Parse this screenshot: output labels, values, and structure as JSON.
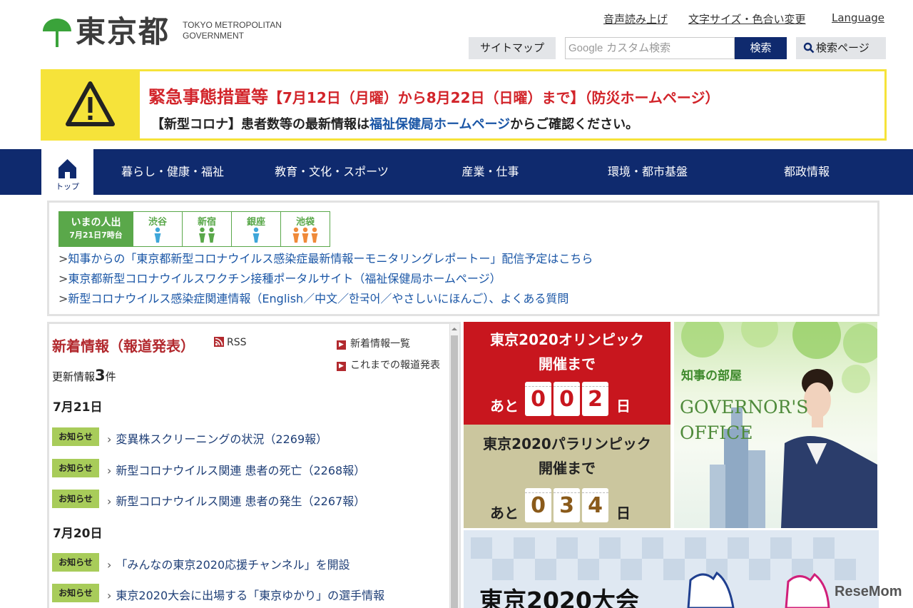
{
  "header": {
    "logo_text": "東京都",
    "logo_en_line1": "TOKYO METROPOLITAN",
    "logo_en_line2": "GOVERNMENT",
    "links": [
      "音声読み上げ",
      "文字サイズ・色合い変更",
      "Language"
    ],
    "sitemap_label": "サイトマップ",
    "search_placeholder": "カスタム検索",
    "search_brand": "Google",
    "search_button": "検索",
    "search_page_button": "検索ページ"
  },
  "alert": {
    "title": "緊急事態措置等",
    "title_sub": "【7月12日（月曜）から8月22日（日曜）まで】（防災ホームページ）",
    "line_prefix": "【新型コロナ】患者数等の最新情報は",
    "line_link": "福祉保健局ホームページ",
    "line_suffix": "からご確認ください。"
  },
  "nav": {
    "home_label": "トップ",
    "items": [
      "暮らし・健康・福祉",
      "教育・文化・スポーツ",
      "産業・仕事",
      "環境・都市基盤",
      "都政情報"
    ]
  },
  "crowd": {
    "label_line1": "いまの人出",
    "label_line2": "7月21日7時台",
    "areas": [
      {
        "name": "渋谷",
        "people": 1,
        "color": "#3fa6d9"
      },
      {
        "name": "新宿",
        "people": 2,
        "color": "#5aa84a"
      },
      {
        "name": "銀座",
        "people": 1,
        "color": "#3fa6d9"
      },
      {
        "name": "池袋",
        "people": 3,
        "color": "#ef8a3a"
      }
    ]
  },
  "covid_links": [
    "知事からの「東京都新型コロナウイルス感染症最新情報ーモニタリングレポートー」配信予定はこちら",
    "東京都新型コロナウイルスワクチン接種ポータルサイト（福祉保健局ホームページ）",
    "新型コロナウイルス感染症関連情報（English／中文／한국어／やさしいにほんご）、よくある質問"
  ],
  "news": {
    "title": "新着情報（報道発表）",
    "rss": "RSS",
    "side_links": [
      "新着情報一覧",
      "これまでの報道発表"
    ],
    "update_prefix": "更新情報",
    "update_count": "3",
    "update_suffix": "件",
    "groups": [
      {
        "date": "7月21日",
        "items": [
          {
            "tag": "お知らせ",
            "text": "変異株スクリーニングの状況（2269報）"
          },
          {
            "tag": "お知らせ",
            "text": "新型コロナウイルス関連 患者の死亡（2268報）"
          },
          {
            "tag": "お知らせ",
            "text": "新型コロナウイルス関連 患者の発生（2267報）"
          }
        ]
      },
      {
        "date": "7月20日",
        "items": [
          {
            "tag": "お知らせ",
            "text": "「みんなの東京2020応援チャンネル」を開設"
          },
          {
            "tag": "お知らせ",
            "text": "東京2020大会に出場する「東京ゆかり」の選手情報"
          }
        ]
      }
    ]
  },
  "olympics": {
    "title_line1": "東京2020オリンピック",
    "title_line2": "開催まで",
    "ato": "あと",
    "digits": [
      "0",
      "0",
      "2"
    ],
    "unit": "日"
  },
  "paralympics": {
    "title_line1": "東京2020パラリンピック",
    "title_line2": "開催まで",
    "ato": "あと",
    "digits": [
      "0",
      "3",
      "4"
    ],
    "unit": "日"
  },
  "governor": {
    "jp": "知事の部屋",
    "en_line1": "GOVERNOR'S",
    "en_line2": "OFFICE"
  },
  "games_banner": {
    "title": "東京2020大会"
  },
  "watermark": "ReseMom",
  "colors": {
    "navy": "#0f2a6e",
    "alert_red": "#d2242a",
    "alert_yellow": "#f6e33a",
    "olympic_red": "#c8161e",
    "para_beige": "#cbc69e",
    "tag_green": "#a8cc5a"
  }
}
